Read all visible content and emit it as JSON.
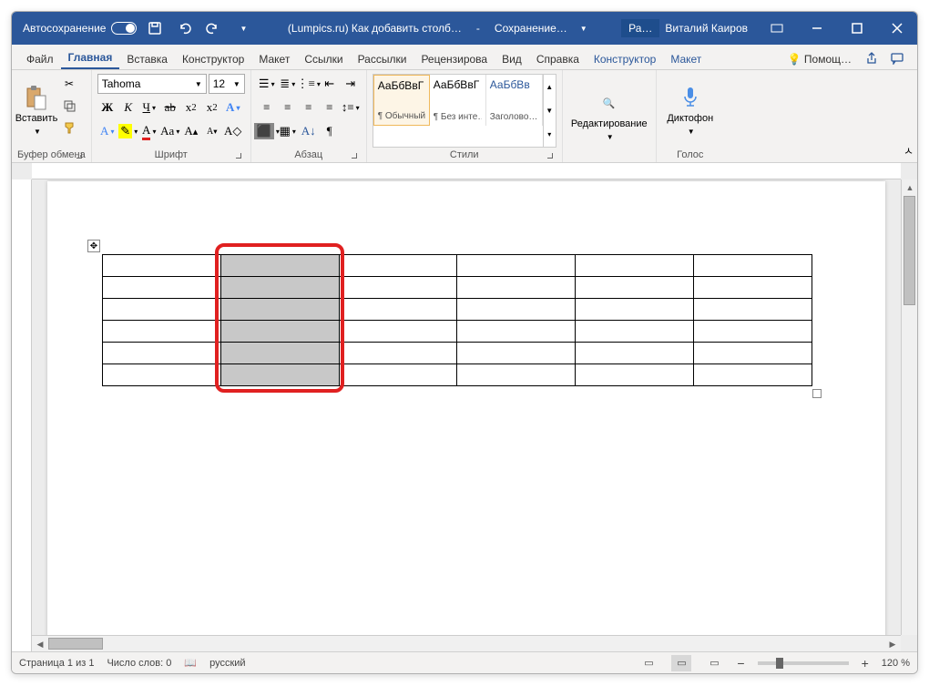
{
  "titlebar": {
    "autosave": "Автосохранение",
    "doc_title": "(Lumpics.ru) Как добавить столб… ",
    "save_status": "Сохранение… ",
    "app_badge": "Ра…",
    "user": "Виталий Каиров"
  },
  "tabs": {
    "file": "Файл",
    "home": "Главная",
    "insert": "Вставка",
    "design": "Конструктор",
    "layout": "Макет",
    "references": "Ссылки",
    "mailings": "Рассылки",
    "review": "Рецензирова",
    "view": "Вид",
    "help": "Справка",
    "table_design": "Конструктор",
    "table_layout": "Макет",
    "tell_me": "Помощ…"
  },
  "ribbon": {
    "paste": "Вставить",
    "clipboard_group": "Буфер обмена",
    "font_name": "Tahoma",
    "font_size": "12",
    "font_group": "Шрифт",
    "paragraph_group": "Абзац",
    "styles_group": "Стили",
    "style1_preview": "АаБбВвГ",
    "style1_name": "¶ Обычный",
    "style2_preview": "АаБбВвГ",
    "style2_name": "¶ Без инте…",
    "style3_preview": "АаБбВв",
    "style3_name": "Заголово…",
    "editing": "Редактирование",
    "voice_group": "Голос",
    "dictate": "Диктофон"
  },
  "table": {
    "rows": 6,
    "cols": 6,
    "selected_col": 1
  },
  "statusbar": {
    "page": "Страница 1 из 1",
    "words": "Число слов: 0",
    "language": "русский",
    "zoom": "120 %",
    "zoom_minus": "−",
    "zoom_plus": "+"
  }
}
